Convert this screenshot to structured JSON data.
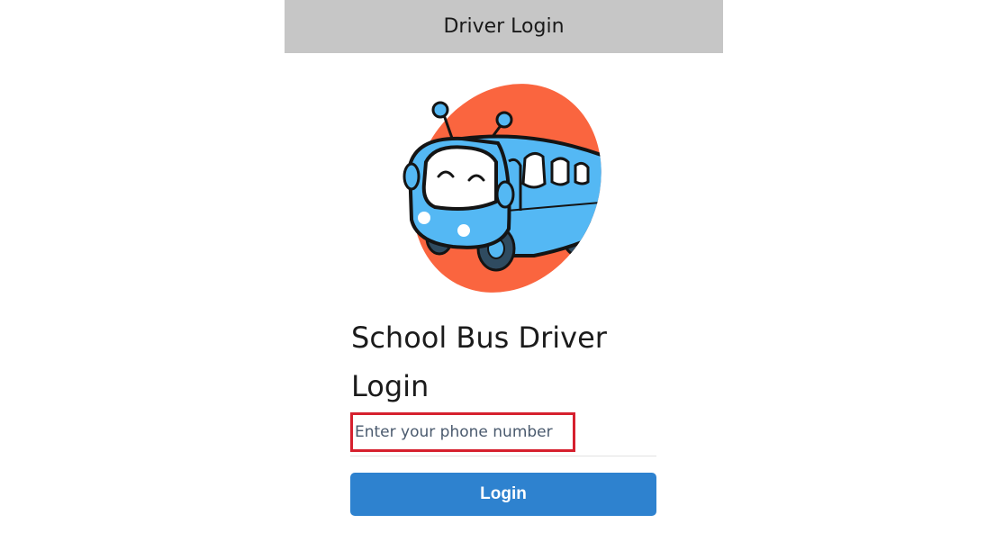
{
  "header": {
    "title": "Driver Login"
  },
  "logo": {
    "icon": "school-bus-icon",
    "colors": {
      "blob": "#fa653f",
      "bus": "#54b8f4",
      "outline": "#141414"
    }
  },
  "main": {
    "title": "School Bus Driver Login",
    "phone_placeholder": "Enter your phone number",
    "phone_value": "",
    "login_label": "Login"
  },
  "colors": {
    "header_bg": "#c6c6c6",
    "button_bg": "#2e82cf",
    "highlight": "#d6202e"
  }
}
